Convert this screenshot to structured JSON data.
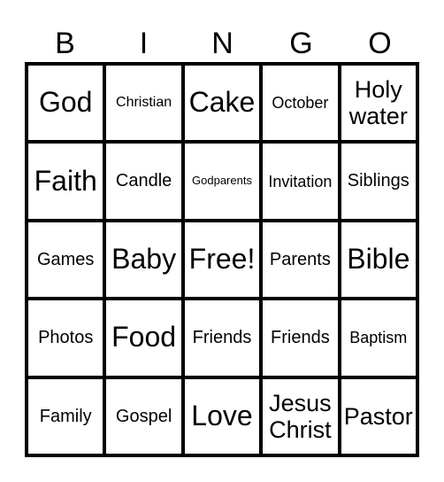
{
  "header": [
    "B",
    "I",
    "N",
    "G",
    "O"
  ],
  "cells": [
    {
      "text": "God",
      "size": "xl"
    },
    {
      "text": "Christian",
      "size": "xs"
    },
    {
      "text": "Cake",
      "size": "xl"
    },
    {
      "text": "October",
      "size": "s"
    },
    {
      "text": "Holy water",
      "size": "l"
    },
    {
      "text": "Faith",
      "size": "xl"
    },
    {
      "text": "Candle",
      "size": "m"
    },
    {
      "text": "Godparents",
      "size": "xxs"
    },
    {
      "text": "Invitation",
      "size": "s"
    },
    {
      "text": "Siblings",
      "size": "m"
    },
    {
      "text": "Games",
      "size": "m"
    },
    {
      "text": "Baby",
      "size": "xl"
    },
    {
      "text": "Free!",
      "size": "xl"
    },
    {
      "text": "Parents",
      "size": "m"
    },
    {
      "text": "Bible",
      "size": "xl"
    },
    {
      "text": "Photos",
      "size": "m"
    },
    {
      "text": "Food",
      "size": "xl"
    },
    {
      "text": "Friends",
      "size": "m"
    },
    {
      "text": "Friends",
      "size": "m"
    },
    {
      "text": "Baptism",
      "size": "s"
    },
    {
      "text": "Family",
      "size": "m"
    },
    {
      "text": "Gospel",
      "size": "m"
    },
    {
      "text": "Love",
      "size": "xl"
    },
    {
      "text": "Jesus Christ",
      "size": "l"
    },
    {
      "text": "Pastor",
      "size": "l"
    }
  ]
}
